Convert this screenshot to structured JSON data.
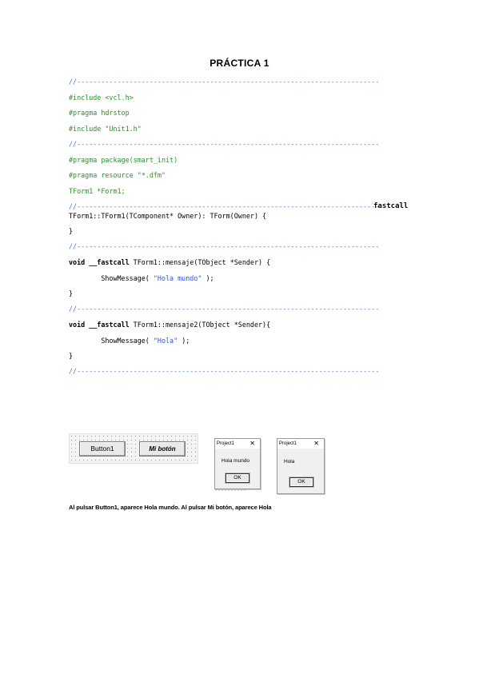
{
  "title": "PRÁCTICA 1",
  "code": {
    "sep": "//---------------------------------------------------------------------------",
    "sep_short": "//---------------------------------------------------------------------------",
    "include_vcl": "#include <vcl.h>",
    "pragma_hdrstop": "#pragma hdrstop",
    "include_unit": "#include \"Unit1.h\"",
    "pragma_package": "#pragma package(smart_init)",
    "pragma_resource": "#pragma resource \"*.dfm\"",
    "form_decl": "TForm1 *Form1;",
    "fastcall_tag": "fastcall",
    "ctor": "TForm1::TForm1(TComponent* Owner): TForm(Owner) {",
    "brace_close": "}",
    "kw_void": "void __fastcall",
    "mensaje_sig": " TForm1::mensaje(TObject *Sender) {",
    "mensaje2_sig": " TForm1::mensaje2(TObject *Sender){",
    "show_prefix": "        ShowMessage( ",
    "show_suffix": " );",
    "str_hola_mundo": "\"Hola mundo\"",
    "str_hola": "\"Hola\""
  },
  "designer": {
    "button1_label": "Button1",
    "button2_label": "Mi botón"
  },
  "dialog1": {
    "title": "Project1",
    "close": "✕",
    "message": "Hola mundo",
    "ok": "OK"
  },
  "dialog2": {
    "title": "Project1",
    "close": "✕",
    "message": "Hola",
    "ok": "OK"
  },
  "caption": "Al pulsar Button1, aparece Hola mundo. Al pulsar Mi botón, aparece Hola"
}
